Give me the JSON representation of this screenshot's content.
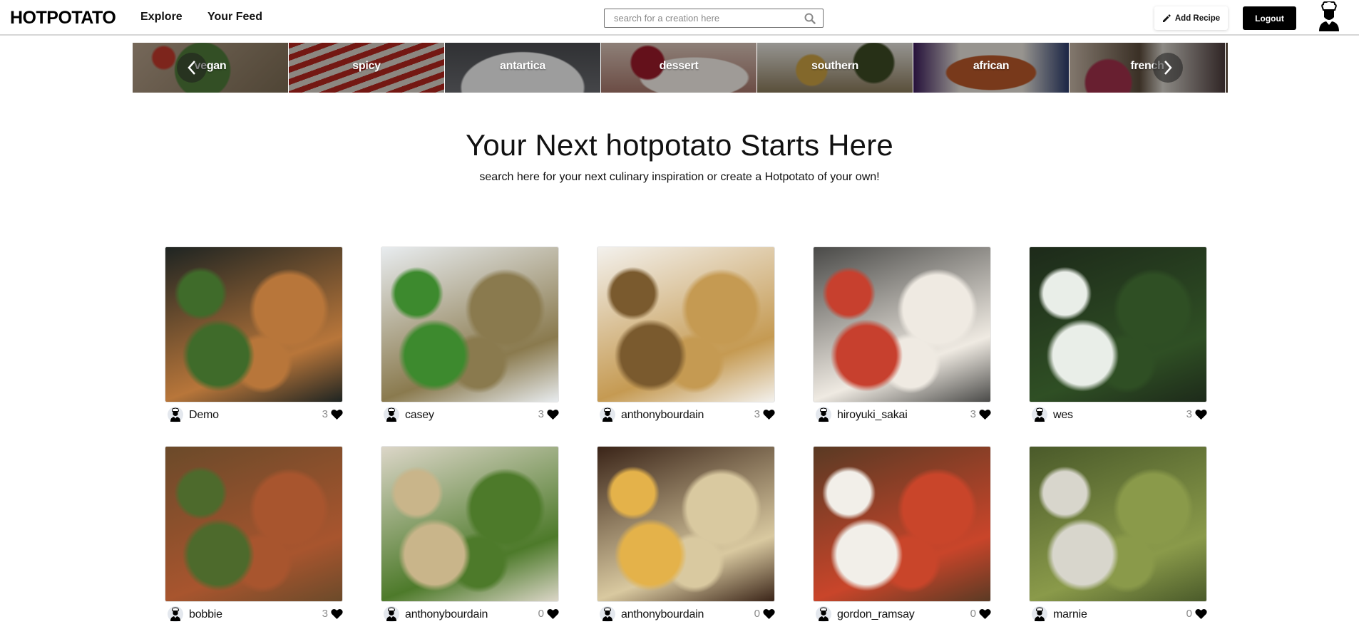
{
  "navbar": {
    "logo": "HOTPOTATO",
    "links": [
      {
        "label": "Explore"
      },
      {
        "label": "Your Feed"
      }
    ],
    "search": {
      "placeholder": "search for a creation here",
      "value": "",
      "icon": "search-icon"
    },
    "add_recipe_label": "Add Recipe",
    "add_recipe_icon": "pencil-icon",
    "logout_label": "Logout",
    "profile_icon": "chef-avatar-icon"
  },
  "categories": {
    "prev_icon": "chevron-left-icon",
    "next_icon": "chevron-right-icon",
    "items": [
      {
        "label": "vegan",
        "color": "#7a6a52"
      },
      {
        "label": "spicy",
        "color": "#a53a2c"
      },
      {
        "label": "antartica",
        "color": "#5a5b5e"
      },
      {
        "label": "dessert",
        "color": "#b58a7c"
      },
      {
        "label": "southern",
        "color": "#6b5a3c"
      },
      {
        "label": "african",
        "color": "#7a3b2a"
      },
      {
        "label": "french",
        "color": "#6a5a66"
      }
    ]
  },
  "hero": {
    "title": "Your Next hotpotato Starts Here",
    "subtitle": "search here for your next culinary inspiration or create a Hotpotato of your own!"
  },
  "recipes": [
    {
      "author": "Demo",
      "likes": "3",
      "colors": [
        "#1e2422",
        "#b8763a",
        "#3f6b2a"
      ]
    },
    {
      "author": "casey",
      "likes": "3",
      "colors": [
        "#e8ecef",
        "#8a7a4e",
        "#3d8a2e"
      ]
    },
    {
      "author": "anthonybourdain",
      "likes": "3",
      "colors": [
        "#f3f1ed",
        "#c59a52",
        "#7a5a2e"
      ]
    },
    {
      "author": "hiroyuki_sakai",
      "likes": "3",
      "colors": [
        "#4a4a48",
        "#efeae2",
        "#c7402e"
      ]
    },
    {
      "author": "wes",
      "likes": "3",
      "colors": [
        "#1d2a1a",
        "#2f4f24",
        "#e9eee8"
      ]
    },
    {
      "author": "bobbie",
      "likes": "3",
      "colors": [
        "#6b4a2a",
        "#a8552e",
        "#4d6a2c"
      ]
    },
    {
      "author": "anthonybourdain",
      "likes": "0",
      "colors": [
        "#dcd6c8",
        "#4d7a2a",
        "#c9b58a"
      ]
    },
    {
      "author": "anthonybourdain",
      "likes": "0",
      "colors": [
        "#3a2418",
        "#d9c9a0",
        "#e4b24a"
      ]
    },
    {
      "author": "gordon_ramsay",
      "likes": "0",
      "colors": [
        "#5a3a24",
        "#c9452a",
        "#f2efe9"
      ]
    },
    {
      "author": "marnie",
      "likes": "0",
      "colors": [
        "#4a5a2a",
        "#8a9a4a",
        "#d8d6cc"
      ]
    }
  ]
}
